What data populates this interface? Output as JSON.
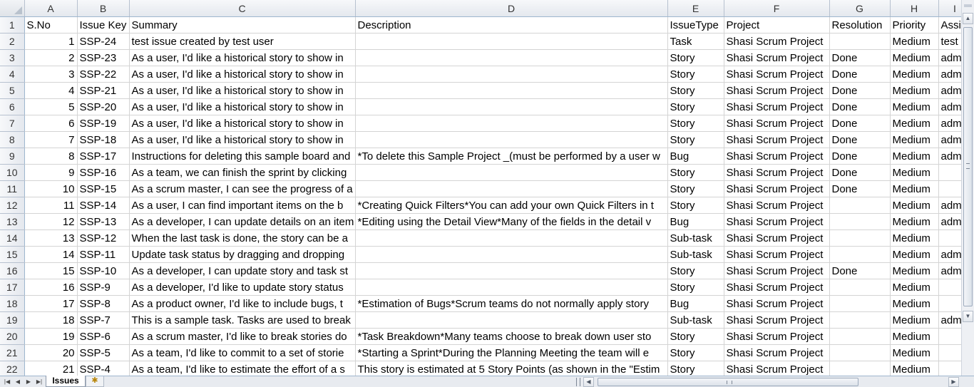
{
  "columns": [
    {
      "letter": "A"
    },
    {
      "letter": "B"
    },
    {
      "letter": "C"
    },
    {
      "letter": "D"
    },
    {
      "letter": "E"
    },
    {
      "letter": "F"
    },
    {
      "letter": "G"
    },
    {
      "letter": "H"
    },
    {
      "letter": "I"
    }
  ],
  "header_row": {
    "row_num": "1",
    "cells": [
      "S.No",
      "Issue Key",
      "Summary",
      "Description",
      "IssueType",
      "Project",
      "Resolution",
      "Priority",
      "Assignee"
    ]
  },
  "rows": [
    {
      "row_num": "2",
      "cells": [
        "1",
        "SSP-24",
        "test issue created by test user",
        "",
        "Task",
        "Shasi Scrum Project",
        "",
        "Medium",
        "test"
      ]
    },
    {
      "row_num": "3",
      "cells": [
        "2",
        "SSP-23",
        "As a user, I'd like a historical story to show in",
        "",
        "Story",
        "Shasi Scrum Project",
        "Done",
        "Medium",
        "admin"
      ]
    },
    {
      "row_num": "4",
      "cells": [
        "3",
        "SSP-22",
        "As a user, I'd like a historical story to show in",
        "",
        "Story",
        "Shasi Scrum Project",
        "Done",
        "Medium",
        "admin"
      ]
    },
    {
      "row_num": "5",
      "cells": [
        "4",
        "SSP-21",
        "As a user, I'd like a historical story to show in",
        "",
        "Story",
        "Shasi Scrum Project",
        "Done",
        "Medium",
        "admin"
      ]
    },
    {
      "row_num": "6",
      "cells": [
        "5",
        "SSP-20",
        "As a user, I'd like a historical story to show in",
        "",
        "Story",
        "Shasi Scrum Project",
        "Done",
        "Medium",
        "admin"
      ]
    },
    {
      "row_num": "7",
      "cells": [
        "6",
        "SSP-19",
        "As a user, I'd like a historical story to show in",
        "",
        "Story",
        "Shasi Scrum Project",
        "Done",
        "Medium",
        "admin"
      ]
    },
    {
      "row_num": "8",
      "cells": [
        "7",
        "SSP-18",
        "As a user, I'd like a historical story to show in",
        "",
        "Story",
        "Shasi Scrum Project",
        "Done",
        "Medium",
        "admin"
      ]
    },
    {
      "row_num": "9",
      "cells": [
        "8",
        "SSP-17",
        "Instructions for deleting this sample board and",
        "*To delete this Sample Project _(must be performed by a user w",
        "Bug",
        "Shasi Scrum Project",
        "Done",
        "Medium",
        "admin"
      ]
    },
    {
      "row_num": "10",
      "cells": [
        "9",
        "SSP-16",
        "As a team, we can finish the sprint by clicking",
        "",
        "Story",
        "Shasi Scrum Project",
        "Done",
        "Medium",
        ""
      ]
    },
    {
      "row_num": "11",
      "cells": [
        "10",
        "SSP-15",
        "As a scrum master, I can see the progress of a",
        "",
        "Story",
        "Shasi Scrum Project",
        "Done",
        "Medium",
        ""
      ]
    },
    {
      "row_num": "12",
      "cells": [
        "11",
        "SSP-14",
        "As a user, I can find important items on the b",
        "*Creating Quick Filters*You can add your own Quick Filters in t",
        "Story",
        "Shasi Scrum Project",
        "",
        "Medium",
        "admin"
      ]
    },
    {
      "row_num": "13",
      "cells": [
        "12",
        "SSP-13",
        "As a developer, I can update details on an item",
        "*Editing using the Detail View*Many of the fields in the detail v",
        "Bug",
        "Shasi Scrum Project",
        "",
        "Medium",
        "admin"
      ]
    },
    {
      "row_num": "14",
      "cells": [
        "13",
        "SSP-12",
        "When the last task is done, the story can be a",
        "",
        "Sub-task",
        "Shasi Scrum Project",
        "",
        "Medium",
        ""
      ]
    },
    {
      "row_num": "15",
      "cells": [
        "14",
        "SSP-11",
        "Update task status by dragging and dropping",
        "",
        "Sub-task",
        "Shasi Scrum Project",
        "",
        "Medium",
        "admin"
      ]
    },
    {
      "row_num": "16",
      "cells": [
        "15",
        "SSP-10",
        "As a developer, I can update story and task st",
        "",
        "Story",
        "Shasi Scrum Project",
        "Done",
        "Medium",
        "admin"
      ]
    },
    {
      "row_num": "17",
      "cells": [
        "16",
        "SSP-9",
        "As a developer, I'd like to update story status",
        "",
        "Story",
        "Shasi Scrum Project",
        "",
        "Medium",
        ""
      ]
    },
    {
      "row_num": "18",
      "cells": [
        "17",
        "SSP-8",
        "As a product owner, I'd like to include bugs, t",
        "*Estimation of Bugs*Scrum teams do not normally apply story",
        "Bug",
        "Shasi Scrum Project",
        "",
        "Medium",
        ""
      ]
    },
    {
      "row_num": "19",
      "cells": [
        "18",
        "SSP-7",
        "This is a sample task. Tasks are used to break",
        "",
        "Sub-task",
        "Shasi Scrum Project",
        "",
        "Medium",
        "admin"
      ]
    },
    {
      "row_num": "20",
      "cells": [
        "19",
        "SSP-6",
        "As a scrum master, I'd like to break stories do",
        "*Task Breakdown*Many teams choose to break down user sto",
        "Story",
        "Shasi Scrum Project",
        "",
        "Medium",
        ""
      ]
    },
    {
      "row_num": "21",
      "cells": [
        "20",
        "SSP-5",
        "As a team, I'd like to commit to a set of storie",
        "*Starting a Sprint*During the Planning Meeting the team will e",
        "Story",
        "Shasi Scrum Project",
        "",
        "Medium",
        ""
      ]
    },
    {
      "row_num": "22",
      "cells": [
        "21",
        "SSP-4",
        "As a team, I'd like to estimate the effort of a s",
        "This story is estimated at 5 Story Points (as shown in the \"Estim",
        "Story",
        "Shasi Scrum Project",
        "",
        "Medium",
        ""
      ]
    }
  ],
  "sheet_tabs": [
    {
      "label": "Issues"
    }
  ],
  "icons": {
    "first": "first-sheet-icon",
    "prev": "prev-sheet-icon",
    "next": "next-sheet-icon",
    "last": "last-sheet-icon",
    "insert_sheet": "insert-sheet-icon",
    "scroll_up": "scroll-up-icon",
    "scroll_down": "scroll-down-icon",
    "scroll_left": "scroll-left-icon",
    "scroll_right": "scroll-right-icon"
  },
  "colors": {
    "grid_line": "#d4d4d4",
    "header_bg": "#e4e8ee",
    "header_border": "#9eb6ce"
  }
}
